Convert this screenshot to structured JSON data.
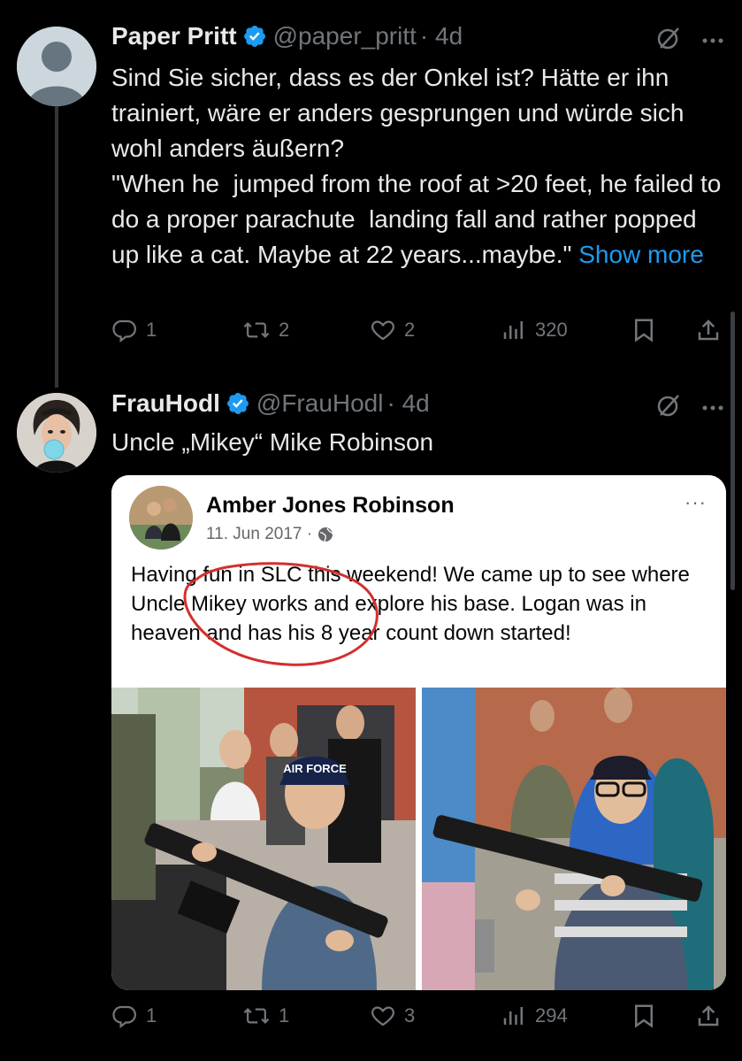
{
  "tweets": [
    {
      "name": "Paper Pritt",
      "handle": "@paper_pritt",
      "time": "· 4d",
      "text": "Sind Sie sicher, dass es der Onkel ist? Hätte er ihn trainiert, wäre er anders gesprungen und würde sich wohl anders äußern?\n\"When he  jumped from the roof at >20 feet, he failed to do a proper parachute  landing fall and rather popped up like a cat. Maybe at 22 years...maybe.\" ",
      "show_more": "Show more",
      "replies": "1",
      "reposts": "2",
      "likes": "2",
      "views": "320"
    },
    {
      "name": "FrauHodl",
      "handle": "@FrauHodl",
      "time": "· 4d",
      "text": "Uncle „Mikey“ Mike Robinson",
      "replies": "1",
      "reposts": "1",
      "likes": "3",
      "views": "294"
    }
  ],
  "embedded_post": {
    "author": "Amber Jones Robinson",
    "date": "11. Jun 2017 ·",
    "text": "Having fun in SLC this weekend! We came up to see where Uncle Mikey works and explore his base. Logan was in heaven and has his 8 year count down started!",
    "more": "···",
    "printed_on_photo_cap": "AIR FORCE"
  },
  "icons": {
    "verified": "verified-badge-icon",
    "grok": "grok-icon",
    "more": "more-icon",
    "reply": "reply-icon",
    "repost": "repost-icon",
    "like": "like-icon",
    "views": "views-icon",
    "bookmark": "bookmark-icon",
    "share": "share-icon",
    "globe": "globe-icon"
  },
  "colors": {
    "background": "#000000",
    "text": "#e7e9ea",
    "muted": "#71767b",
    "link": "#1d9bf0",
    "verified": "#1d9bf0",
    "annotation_circle": "#d32f2f"
  }
}
